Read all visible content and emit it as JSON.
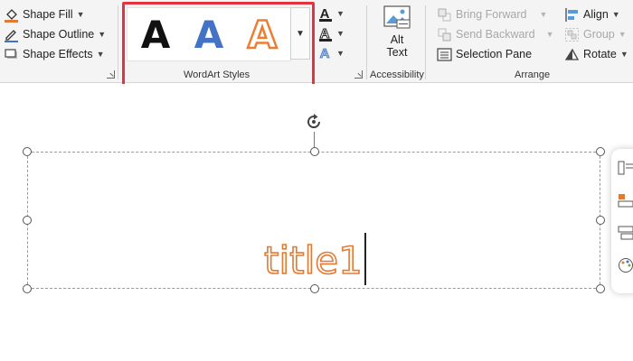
{
  "shape_styles": {
    "shape_fill": "Shape Fill",
    "shape_outline": "Shape Outline",
    "shape_effects": "Shape Effects"
  },
  "wordart": {
    "group_label": "WordArt Styles",
    "styles": [
      {
        "glyph": "A",
        "fill": "#111111",
        "outline": "none"
      },
      {
        "glyph": "A",
        "fill": "#4472c4",
        "outline": "none"
      },
      {
        "glyph": "A",
        "fill": "#ffffff",
        "outline": "#ed7d31"
      }
    ]
  },
  "text_tools": {
    "text_fill_glyph": "A",
    "text_outline_glyph": "A",
    "text_effects_glyph": "A"
  },
  "accessibility": {
    "alt_text_line1": "Alt",
    "alt_text_line2": "Text",
    "group_label": "Accessibility"
  },
  "arrange": {
    "bring_forward": "Bring Forward",
    "send_backward": "Send Backward",
    "selection_pane": "Selection Pane",
    "align": "Align",
    "group": "Group",
    "rotate": "Rotate",
    "group_label": "Arrange"
  },
  "slide": {
    "title_text": "title1",
    "title_color": "#e37a33"
  }
}
